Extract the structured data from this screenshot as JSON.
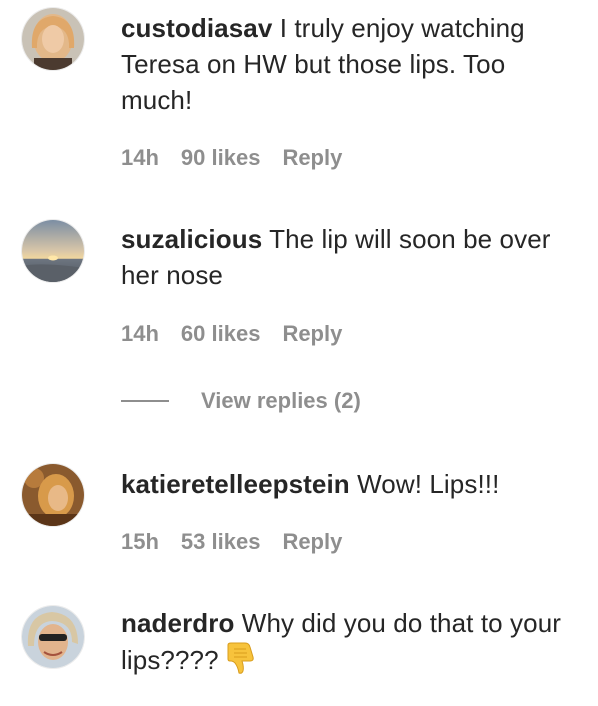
{
  "comments": [
    {
      "username": "custodiasav",
      "text": " I truly enjoy watching Teresa on HW but those lips. Too much!",
      "time": "14h",
      "likes": "90 likes",
      "reply": "Reply"
    },
    {
      "username": "suzalicious",
      "text": " The lip will soon be over her nose",
      "time": "14h",
      "likes": "60 likes",
      "reply": "Reply",
      "view_replies": "View replies (2)"
    },
    {
      "username": "katieretelleepstein",
      "text": " Wow! Lips!!!",
      "time": "15h",
      "likes": "53 likes",
      "reply": "Reply"
    },
    {
      "username": "naderdro",
      "text": " Why did you do that to your lips????",
      "emoji": "thumbs-down-icon"
    }
  ],
  "colors": {
    "text": "#262626",
    "meta": "#8e8e8e",
    "emoji": "#f7c33c"
  }
}
